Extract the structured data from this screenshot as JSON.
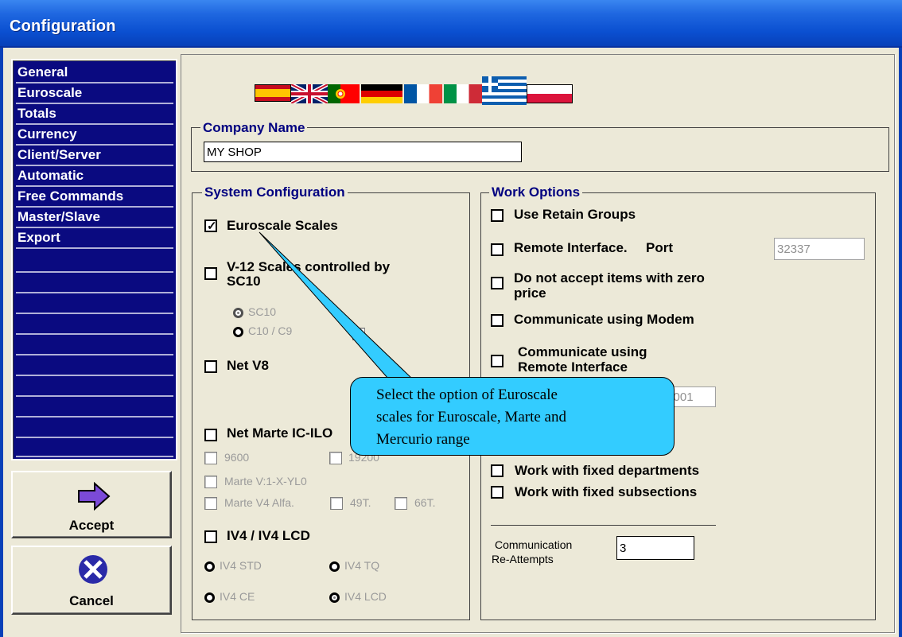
{
  "window": {
    "title": "Configuration"
  },
  "sidebar": {
    "items": [
      {
        "label": "General"
      },
      {
        "label": "Euroscale"
      },
      {
        "label": "Totals"
      },
      {
        "label": "Currency"
      },
      {
        "label": "Client/Server"
      },
      {
        "label": "Automatic"
      },
      {
        "label": "Free Commands"
      },
      {
        "label": "Master/Slave"
      },
      {
        "label": "Export"
      }
    ]
  },
  "buttons": {
    "accept": "Accept",
    "cancel": "Cancel"
  },
  "flags": [
    "spanish-flag",
    "uk-flag",
    "portuguese-flag",
    "german-flag",
    "french-flag",
    "italian-flag",
    "greek-flag",
    "polish-flag"
  ],
  "company": {
    "title": "Company Name",
    "value": "MY SHOP"
  },
  "system_config": {
    "title": "System Configuration",
    "euroscale": {
      "label": "Euroscale Scales",
      "checked": true
    },
    "v12": {
      "label_line1": "V-12 Scales controlled  by",
      "label_line2": "SC10"
    },
    "sc10": "SC10",
    "c10": "C10 / C9",
    "net_v8": "Net V8",
    "net_marte": "Net Marte IC-ILO",
    "baud_9600": "9600",
    "baud_19200": "19200",
    "marte_v1": "Marte V:1-X-YL0",
    "marte_v4": "Marte V4 Alfa.",
    "t49": "49T.",
    "t66": "66T.",
    "iv4": "IV4 / IV4 LCD",
    "iv4_std": "IV4 STD",
    "iv4_tq": "IV4 TQ",
    "iv4_ce": "IV4 CE",
    "iv4_lcd": "IV4 LCD"
  },
  "work_options": {
    "title": "Work Options",
    "retain": "Use Retain Groups",
    "remote": "Remote Interface.",
    "port_label": "Port",
    "port_value": "32337",
    "zero_line1": "Do not accept items with zero",
    "zero_line2": "price",
    "modem": "Communicate using Modem",
    "remote_comm_line1": "Communicate using",
    "remote_comm_line2": "Remote Interface",
    "value_field": "0.001",
    "fixed_depts": "Work with fixed departments",
    "fixed_subsections": "Work with fixed subsections",
    "reattempts_line1": "Communication",
    "reattempts_line2": "Re-Attempts",
    "reattempts_value": "3"
  },
  "callout": {
    "line1": "Select the option of Euroscale",
    "line2": "scales for Euroscale, Marte and",
    "line3": "Mercurio range"
  }
}
